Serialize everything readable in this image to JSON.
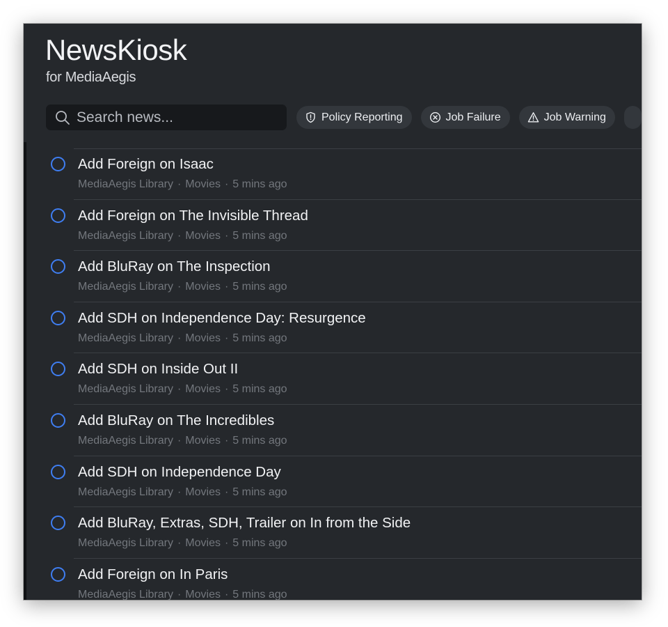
{
  "app": {
    "title": "NewsKiosk",
    "subtitle": "for MediaAegis"
  },
  "search": {
    "placeholder": "Search news..."
  },
  "filters": [
    {
      "label": "Policy Reporting",
      "icon": "shield-alert-icon"
    },
    {
      "label": "Job Failure",
      "icon": "circle-x-icon"
    },
    {
      "label": "Job Warning",
      "icon": "warning-triangle-icon"
    }
  ],
  "news": [
    {
      "title": "Add Foreign on Isaac",
      "source": "MediaAegis Library",
      "category": "Movies",
      "time": "5 mins ago"
    },
    {
      "title": "Add Foreign on The Invisible Thread",
      "source": "MediaAegis Library",
      "category": "Movies",
      "time": "5 mins ago"
    },
    {
      "title": "Add BluRay on The Inspection",
      "source": "MediaAegis Library",
      "category": "Movies",
      "time": "5 mins ago"
    },
    {
      "title": "Add SDH on Independence Day: Resurgence",
      "source": "MediaAegis Library",
      "category": "Movies",
      "time": "5 mins ago"
    },
    {
      "title": "Add SDH on Inside Out II",
      "source": "MediaAegis Library",
      "category": "Movies",
      "time": "5 mins ago"
    },
    {
      "title": "Add BluRay on The Incredibles",
      "source": "MediaAegis Library",
      "category": "Movies",
      "time": "5 mins ago"
    },
    {
      "title": "Add SDH on Independence Day",
      "source": "MediaAegis Library",
      "category": "Movies",
      "time": "5 mins ago"
    },
    {
      "title": "Add BluRay, Extras, SDH, Trailer on In from the Side",
      "source": "MediaAegis Library",
      "category": "Movies",
      "time": "5 mins ago"
    },
    {
      "title": "Add Foreign on In Paris",
      "source": "MediaAegis Library",
      "category": "Movies",
      "time": "5 mins ago"
    }
  ],
  "colors": {
    "background": "#25282c",
    "accent": "#3f7ef2",
    "chip": "#33373c",
    "meta_text": "#73777d"
  }
}
